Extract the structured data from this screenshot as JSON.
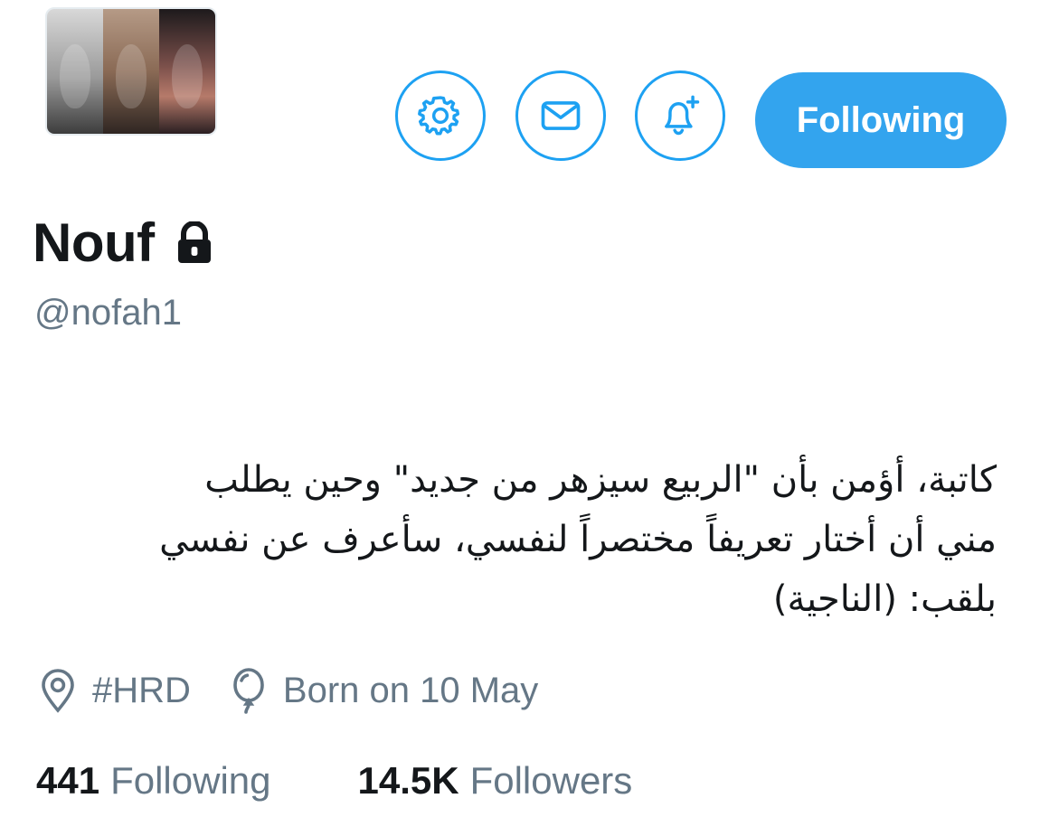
{
  "profile": {
    "display_name": "Nouf",
    "handle": "@nofah1",
    "protected_icon": "lock-icon",
    "bio_lines": [
      "كاتبة، أؤمن بأن \"الربيع سيزهر من جديد\" وحين يطلب",
      "مني أن أختار تعريفاً مختصراً لنفسي، سأعرف عن نفسي",
      "بلقب: (الناجية)"
    ],
    "location": "#HRD",
    "birthday": "Born on 10 May"
  },
  "actions": {
    "settings_icon": "gear-icon",
    "message_icon": "envelope-icon",
    "notify_icon": "bell-plus-icon",
    "follow_label": "Following"
  },
  "stats": {
    "following_count": "441",
    "following_label": "Following",
    "followers_count": "14.5K",
    "followers_label": "Followers"
  },
  "colors": {
    "accent": "#1da1f2",
    "follow_button": "#33a4ee",
    "secondary_text": "#657786",
    "primary_text": "#14171a"
  }
}
